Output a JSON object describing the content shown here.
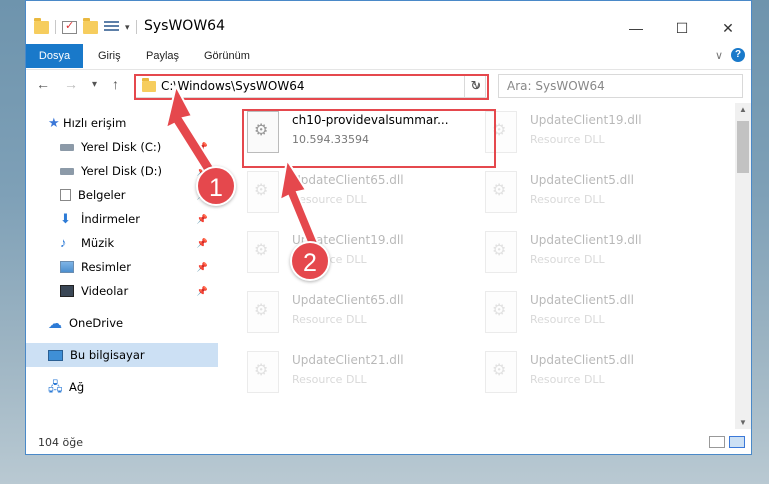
{
  "window": {
    "title": "SysWOW64",
    "controls": {
      "minimize": "—",
      "maximize": "☐",
      "close": "✕"
    }
  },
  "ribbon": {
    "tabs": [
      "Dosya",
      "Giriş",
      "Paylaş",
      "Görünüm"
    ]
  },
  "nav": {
    "back": "←",
    "forward": "→",
    "recent": "▾",
    "up": "↑",
    "address": "C:\\Windows\\SysWOW64",
    "address_dropdown": "∨",
    "refresh": "↻",
    "search_placeholder": "Ara: SysWOW64"
  },
  "sidebar": {
    "items": [
      {
        "label": "Hızlı erişim",
        "icon": "star-icon",
        "pinned": false
      },
      {
        "label": "Yerel Disk (C:)",
        "icon": "drive-icon",
        "pinned": true
      },
      {
        "label": "Yerel Disk (D:)",
        "icon": "drive-icon",
        "pinned": true
      },
      {
        "label": "Belgeler",
        "icon": "documents-icon",
        "pinned": true
      },
      {
        "label": "İndirmeler",
        "icon": "download-icon",
        "pinned": true
      },
      {
        "label": "Müzik",
        "icon": "music-icon",
        "pinned": true
      },
      {
        "label": "Resimler",
        "icon": "pictures-icon",
        "pinned": true
      },
      {
        "label": "Videolar",
        "icon": "videos-icon",
        "pinned": true
      },
      {
        "label": "OneDrive",
        "icon": "cloud-icon",
        "pinned": false
      },
      {
        "label": "Bu bilgisayar",
        "icon": "computer-icon",
        "pinned": false
      },
      {
        "label": "Ağ",
        "icon": "network-icon",
        "pinned": false
      }
    ]
  },
  "files": [
    {
      "name": "ch10-providevalsummar...",
      "meta": "10.594.33594",
      "highlighted": true
    },
    {
      "name": "UpdateClient19.dll",
      "meta": "Resource DLL"
    },
    {
      "name": "UpdateClient65.dll",
      "meta": "Resource DLL"
    },
    {
      "name": "UpdateClient5.dll",
      "meta": "Resource DLL"
    },
    {
      "name": "UpdateClient19.dll",
      "meta": "Resource DLL"
    },
    {
      "name": "UpdateClient19.dll",
      "meta": "Resource DLL"
    },
    {
      "name": "UpdateClient65.dll",
      "meta": "Resource DLL"
    },
    {
      "name": "UpdateClient5.dll",
      "meta": "Resource DLL"
    },
    {
      "name": "UpdateClient21.dll",
      "meta": "Resource DLL"
    },
    {
      "name": "UpdateClient5.dll",
      "meta": "Resource DLL"
    }
  ],
  "status": {
    "count": "104 öğe"
  },
  "annotations": {
    "marker1": "1",
    "marker2": "2",
    "color": "#e5484d"
  },
  "colors": {
    "accent": "#1979ca",
    "selection": "#cce0f4"
  }
}
